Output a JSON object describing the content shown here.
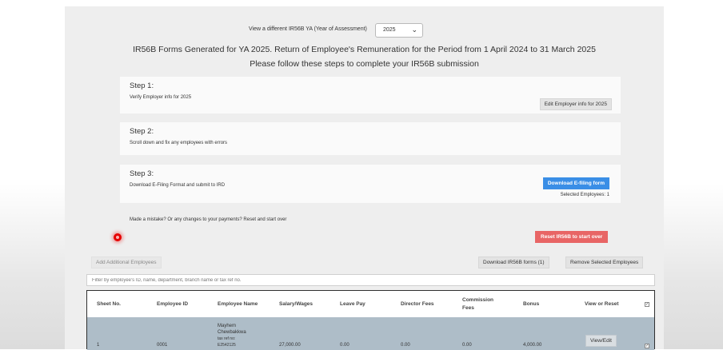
{
  "ya_selector": {
    "label": "View a different IR56B YA (Year of Assessment)",
    "value": "2025"
  },
  "headline": {
    "line1": "IR56B Forms Generated for YA 2025. Return of Employee's Remuneration for the Period from 1 April 2024 to 31 March 2025",
    "line2": "Please follow these steps to complete your IR56B submission"
  },
  "steps": [
    {
      "title": "Step 1:",
      "desc": "Verify Employer info for 2025",
      "button": "Edit Employer info for 2025"
    },
    {
      "title": "Step 2:",
      "desc": "Scroll down and fix any employees with errors"
    },
    {
      "title": "Step 3:",
      "desc": "Download E-Filing Format and submit to IRD",
      "button": "Download E-filing form",
      "selected": "Selected Employees: 1"
    }
  ],
  "reset": {
    "text": "Made a mistake? Or any changes to your payments? Reset and start over",
    "button": "Reset IR56B to start over"
  },
  "toolbar": {
    "add_label": "Add Additional Employees",
    "download_label": "Download IR56B forms (1)",
    "remove_label": "Remove Selected Employees"
  },
  "filter": {
    "placeholder": "Filter by employee's ID, name, department, branch name or tax ref no."
  },
  "table": {
    "headers": [
      "Sheet No.",
      "Employee ID",
      "Employee Name",
      "Salary/Wages",
      "Leave Pay",
      "Director Fees",
      "Commission Fees",
      "Bonus",
      "View or Reset"
    ],
    "rows": [
      {
        "sheet_no": "1",
        "employee_id": "0001",
        "name_lines": [
          "Mayhem",
          "Chewbakkwa",
          "tax ref no:",
          "E2542125"
        ],
        "salary": "27,000.00",
        "leave_pay": "0.00",
        "director_fees": "0.00",
        "commission": "0.00",
        "bonus": "4,000.00",
        "action": "View/Edit"
      }
    ]
  }
}
